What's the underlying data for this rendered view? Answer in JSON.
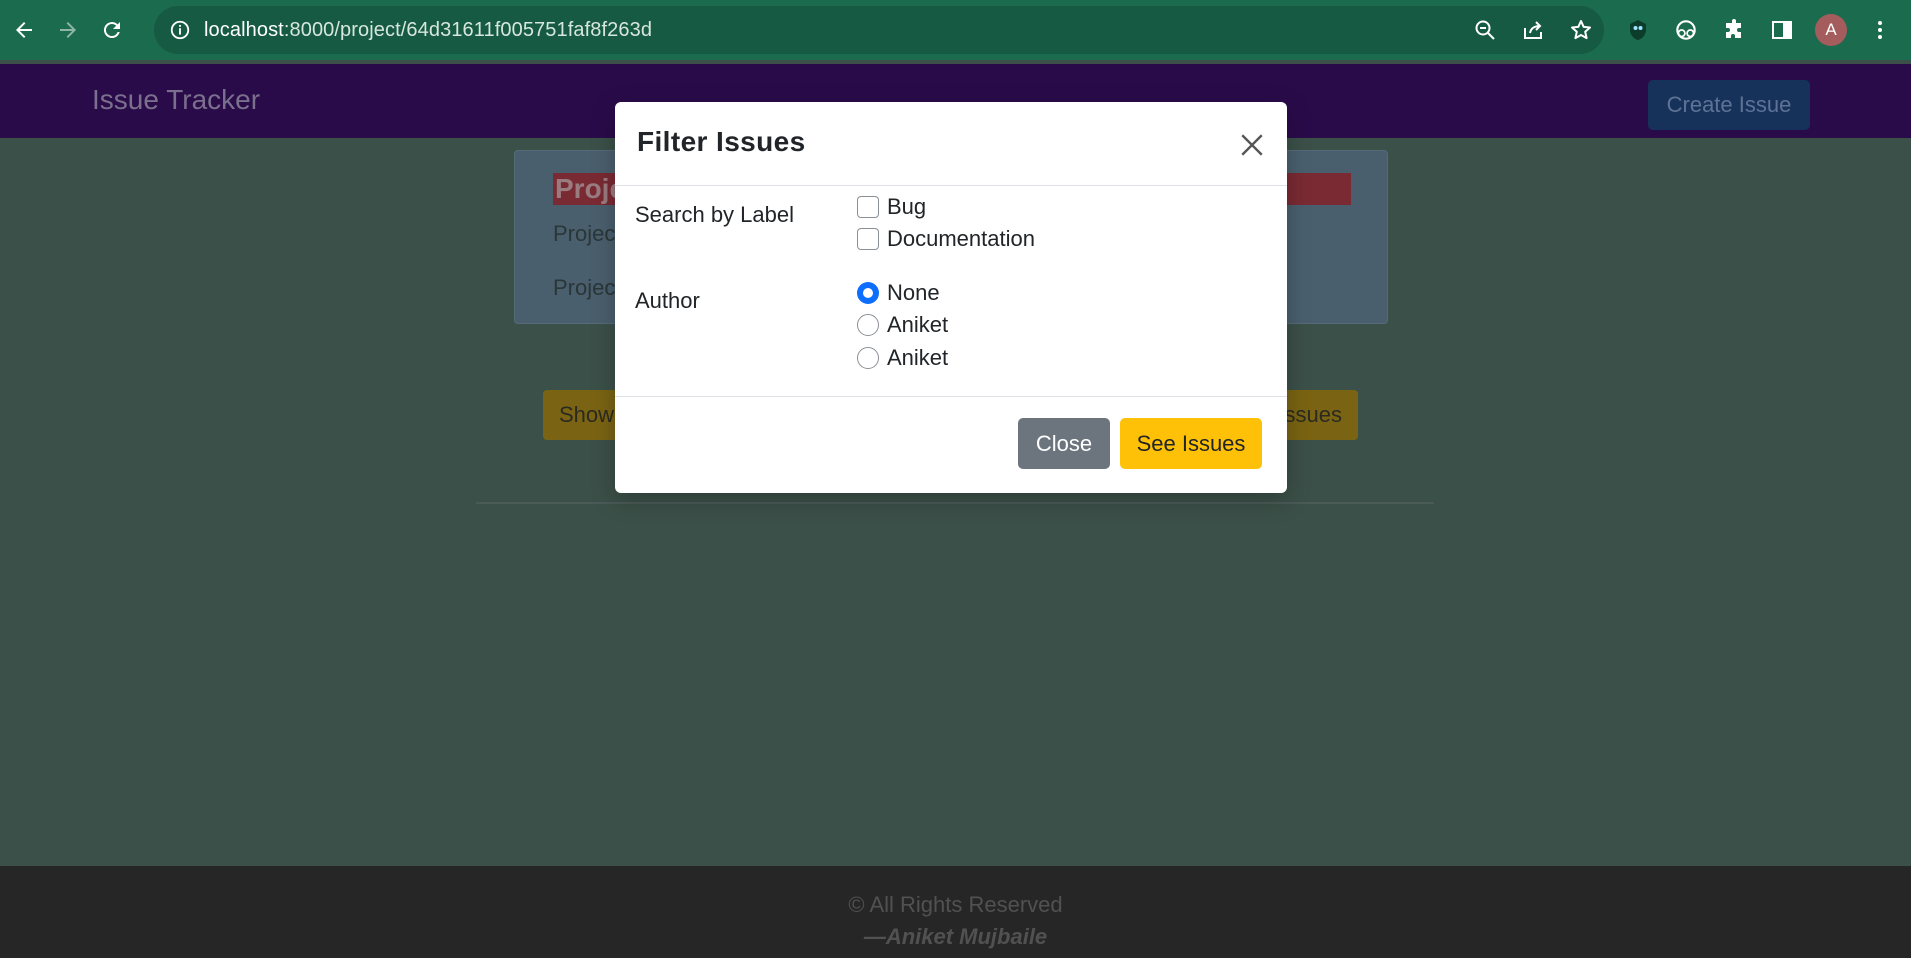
{
  "browser": {
    "url_host": "localhost",
    "url_path": ":8000/project/64d31611f005751faf8f263d",
    "profile_initial": "A",
    "icons": [
      "back-icon",
      "forward-icon",
      "reload-icon",
      "site-info-icon",
      "zoom-out-icon",
      "share-icon",
      "bookmark-star-icon",
      "extension-1-icon",
      "extension-2-icon",
      "puzzle-icon",
      "side-panel-icon",
      "profile-avatar",
      "kebab-menu-icon"
    ]
  },
  "app": {
    "brand": "Issue Tracker",
    "create_issue_label": "Create Issue",
    "project_title_partial": "Proje",
    "project_line1_partial": "Projec",
    "project_line2_partial": "Projec",
    "show_button_partial": "Show",
    "issues_button_partial": "ssues",
    "footer_copyright": "© All Rights Reserved",
    "footer_author": "—Aniket Mujbaile"
  },
  "modal": {
    "title": "Filter Issues",
    "label_section": "Search by Label",
    "label_options": [
      "Bug",
      "Documentation"
    ],
    "author_section": "Author",
    "author_options": [
      "None",
      "Aniket",
      "Aniket"
    ],
    "author_selected": "None",
    "close_label": "Close",
    "see_issues_label": "See Issues"
  },
  "colors": {
    "browser_bar": "#1b6b4f",
    "primary_checked": "#0d6efd",
    "warning_button": "#ffc107",
    "secondary_button": "#6c757d"
  }
}
